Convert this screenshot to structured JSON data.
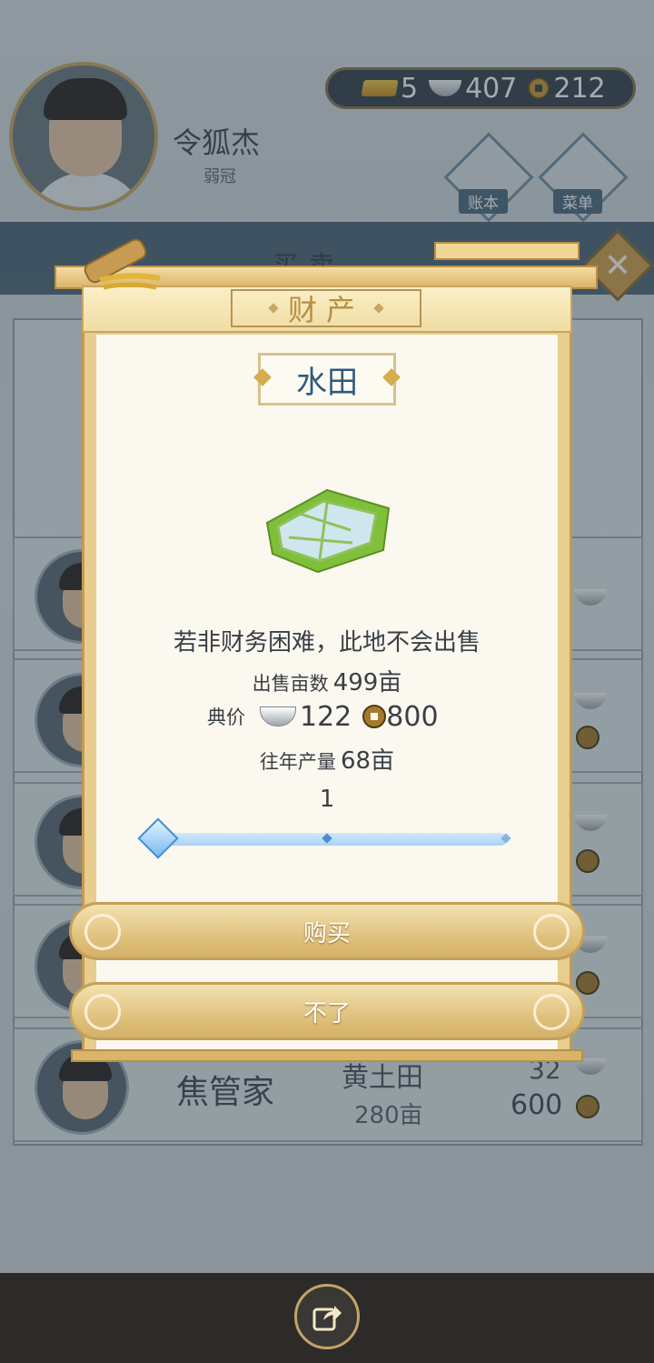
{
  "player": {
    "name": "令狐杰",
    "title": "弱冠"
  },
  "currency": {
    "gold": "5",
    "silver": "407",
    "coin": "212"
  },
  "header_buttons": {
    "ledger": "账本",
    "menu": "菜单"
  },
  "screen_title": "买卖",
  "list": {
    "row_name": "焦管家",
    "row_land": "黄土田",
    "row_land_amount": "280亩",
    "row_silver": "32",
    "row_coin": "600"
  },
  "modal": {
    "header": "财产",
    "item_name": "水田",
    "description": "若非财务困难，此地不会出售",
    "sale_area": {
      "label": "出售亩数",
      "value": "499亩"
    },
    "price": {
      "label": "典价",
      "silver": "122",
      "coin": "800"
    },
    "yield": {
      "label": "往年产量",
      "value": "68亩"
    },
    "quantity": "1",
    "buy_label": "购买",
    "cancel_label": "不了"
  },
  "slider": {
    "min": 1,
    "value": 1
  },
  "colors": {
    "accent_gold": "#d4b068",
    "title_blue": "#2e5a7e",
    "slider_blue": "#3e8fd6"
  },
  "icons": {
    "gold": "gold-ingot-icon",
    "silver": "silver-ingot-icon",
    "coin": "copper-coin-icon",
    "share": "share-icon",
    "close": "close-icon"
  }
}
